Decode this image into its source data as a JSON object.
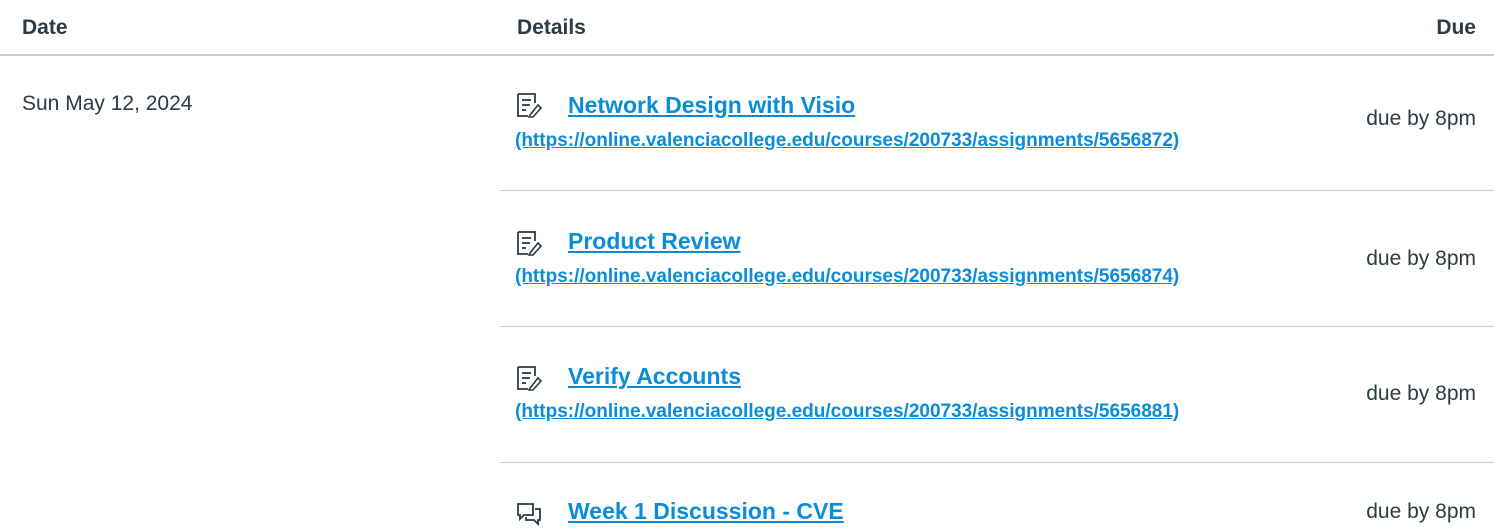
{
  "header": {
    "date": "Date",
    "details": "Details",
    "due": "Due"
  },
  "date_group": "Sun May 12, 2024",
  "assignments": [
    {
      "icon": "assignment-icon",
      "title": "Network Design with Visio",
      "url": "(https://online.valenciacollege.edu/courses/200733/assignments/5656872)",
      "due": "due by 8pm"
    },
    {
      "icon": "assignment-icon",
      "title": "Product Review",
      "url": "(https://online.valenciacollege.edu/courses/200733/assignments/5656874)",
      "due": "due by 8pm"
    },
    {
      "icon": "assignment-icon",
      "title": "Verify Accounts",
      "url": "(https://online.valenciacollege.edu/courses/200733/assignments/5656881)",
      "due": "due by 8pm"
    },
    {
      "icon": "discussion-icon",
      "title": "Week 1 Discussion - CVE",
      "due": "due by 8pm"
    }
  ],
  "colors": {
    "link": "#0b8cd6",
    "text": "#2d3b45",
    "divider": "#c7cdd1"
  }
}
